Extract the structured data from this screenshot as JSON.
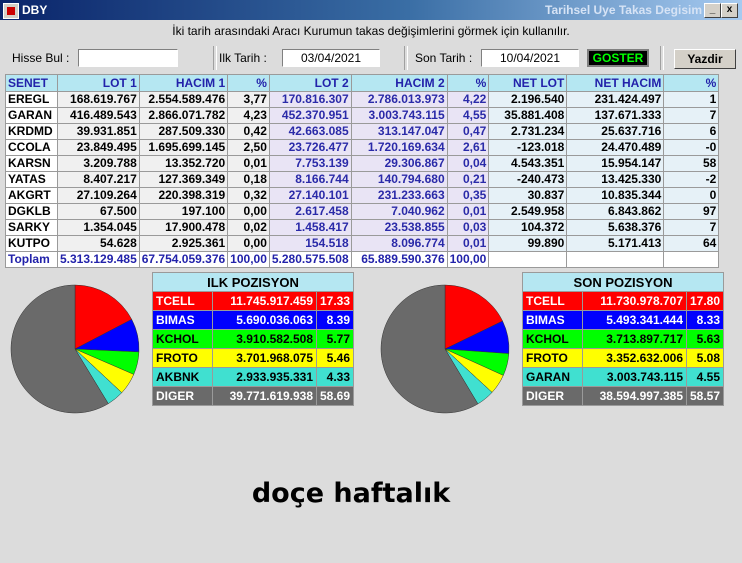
{
  "window": {
    "title": "DBY",
    "right_title": "Tarihsel Uye Takas Degisim",
    "minimize": "_",
    "close": "x"
  },
  "info_text": "İki tarih arasındaki  Aracı Kurumun takas değişimlerini görmek için kullanılır.",
  "toolbar": {
    "hisse_label": "Hisse Bul :",
    "hisse_value": "",
    "ilk_label": "Ilk Tarih :",
    "ilk_value": "03/04/2021",
    "son_label": "Son Tarih :",
    "son_value": "10/04/2021",
    "goster": "GOSTER",
    "yazdir": "Yazdir"
  },
  "grid": {
    "headers": [
      "SENET",
      "LOT 1",
      "HACIM 1",
      "%",
      "LOT 2",
      "HACIM 2",
      "%",
      "NET LOT",
      "NET HACIM",
      "%"
    ],
    "rows": [
      [
        "EREGL",
        "168.619.767",
        "2.554.589.476",
        "3,77",
        "170.816.307",
        "2.786.013.973",
        "4,22",
        "2.196.540",
        "231.424.497",
        "1"
      ],
      [
        "GARAN",
        "416.489.543",
        "2.866.071.782",
        "4,23",
        "452.370.951",
        "3.003.743.115",
        "4,55",
        "35.881.408",
        "137.671.333",
        "7"
      ],
      [
        "KRDMD",
        "39.931.851",
        "287.509.330",
        "0,42",
        "42.663.085",
        "313.147.047",
        "0,47",
        "2.731.234",
        "25.637.716",
        "6"
      ],
      [
        "CCOLA",
        "23.849.495",
        "1.695.699.145",
        "2,50",
        "23.726.477",
        "1.720.169.634",
        "2,61",
        "-123.018",
        "24.470.489",
        "-0"
      ],
      [
        "KARSN",
        "3.209.788",
        "13.352.720",
        "0,01",
        "7.753.139",
        "29.306.867",
        "0,04",
        "4.543.351",
        "15.954.147",
        "58"
      ],
      [
        "YATAS",
        "8.407.217",
        "127.369.349",
        "0,18",
        "8.166.744",
        "140.794.680",
        "0,21",
        "-240.473",
        "13.425.330",
        "-2"
      ],
      [
        "AKGRT",
        "27.109.264",
        "220.398.319",
        "0,32",
        "27.140.101",
        "231.233.663",
        "0,35",
        "30.837",
        "10.835.344",
        "0"
      ],
      [
        "DGKLB",
        "67.500",
        "197.100",
        "0,00",
        "2.617.458",
        "7.040.962",
        "0,01",
        "2.549.958",
        "6.843.862",
        "97"
      ],
      [
        "SARKY",
        "1.354.045",
        "17.900.478",
        "0,02",
        "1.458.417",
        "23.538.855",
        "0,03",
        "104.372",
        "5.638.376",
        "7"
      ],
      [
        "KUTPO",
        "54.628",
        "2.925.361",
        "0,00",
        "154.518",
        "8.096.774",
        "0,01",
        "99.890",
        "5.171.413",
        "64"
      ]
    ],
    "total": [
      "Toplam",
      "5.313.129.485",
      "67.754.059.376",
      "100,00",
      "5.280.575.508",
      "65.889.590.376",
      "100,00",
      "",
      "",
      ""
    ]
  },
  "ilk_pozisyon": {
    "title": "ILK POZISYON",
    "rows": [
      {
        "name": "TCELL",
        "value": "11.745.917.459",
        "pct": "17.33",
        "color": "#ff0000",
        "pct_value": 17.33
      },
      {
        "name": "BIMAS",
        "value": "5.690.036.063",
        "pct": "8.39",
        "color": "#0000ff",
        "pct_value": 8.39
      },
      {
        "name": "KCHOL",
        "value": "3.910.582.508",
        "pct": "5.77",
        "color": "#00ff00",
        "pct_value": 5.77
      },
      {
        "name": "FROTO",
        "value": "3.701.968.075",
        "pct": "5.46",
        "color": "#ffff00",
        "pct_value": 5.46
      },
      {
        "name": "AKBNK",
        "value": "2.933.935.331",
        "pct": "4.33",
        "color": "#40e0d0",
        "pct_value": 4.33
      },
      {
        "name": "DIGER",
        "value": "39.771.619.938",
        "pct": "58.69",
        "color": "#6a6a6a",
        "pct_value": 58.69
      }
    ]
  },
  "son_pozisyon": {
    "title": "SON POZISYON",
    "rows": [
      {
        "name": "TCELL",
        "value": "11.730.978.707",
        "pct": "17.80",
        "color": "#ff0000",
        "pct_value": 17.8
      },
      {
        "name": "BIMAS",
        "value": "5.493.341.444",
        "pct": "8.33",
        "color": "#0000ff",
        "pct_value": 8.33
      },
      {
        "name": "KCHOL",
        "value": "3.713.897.717",
        "pct": "5.63",
        "color": "#00ff00",
        "pct_value": 5.63
      },
      {
        "name": "FROTO",
        "value": "3.352.632.006",
        "pct": "5.08",
        "color": "#ffff00",
        "pct_value": 5.08
      },
      {
        "name": "GARAN",
        "value": "3.003.743.115",
        "pct": "4.55",
        "color": "#40e0d0",
        "pct_value": 4.55
      },
      {
        "name": "DIGER",
        "value": "38.594.997.385",
        "pct": "58.57",
        "color": "#6a6a6a",
        "pct_value": 58.57
      }
    ]
  },
  "watermark": "doçe haftalık"
}
